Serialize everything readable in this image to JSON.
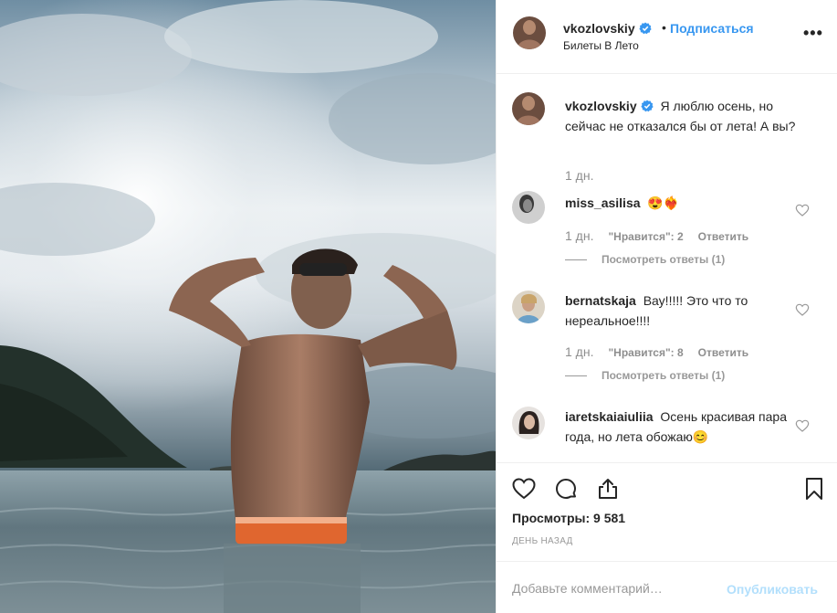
{
  "header": {
    "username": "vkozlovskiy",
    "separator": "•",
    "follow_label": "Подписаться",
    "location": "Билеты В Лето",
    "more_label": "•••"
  },
  "caption": {
    "username": "vkozlovskiy",
    "text": "Я люблю осень, но сейчас не отказался бы от лета! А вы?",
    "age": "1 дн."
  },
  "comments": [
    {
      "username": "miss_asilisa",
      "text": "😍❤️‍🔥",
      "age": "1 дн.",
      "likes": "\"Нравится\": 2",
      "reply_label": "Ответить",
      "view_replies": "Посмотреть ответы (1)"
    },
    {
      "username": "bernatskaja",
      "text": "Вау!!!!! Это что то нереальное!!!!",
      "age": "1 дн.",
      "likes": "\"Нравится\": 8",
      "reply_label": "Ответить",
      "view_replies": "Посмотреть ответы (1)"
    },
    {
      "username": "iaretskaiaiuliia",
      "text": "Осень красивая пара года, но лета обожаю😊"
    }
  ],
  "actions": {
    "views": "Просмотры: 9 581",
    "date": "ДЕНЬ НАЗАД"
  },
  "add_comment": {
    "placeholder": "Добавьте комментарий…",
    "publish_label": "Опубликовать"
  },
  "icons": {
    "verified": "verified-badge-icon",
    "like": "heart-icon",
    "comment": "comment-bubble-icon",
    "share": "share-icon",
    "save": "bookmark-icon"
  },
  "colors": {
    "link_blue": "#3897f0",
    "publish_disabled": "#b2dffc",
    "muted_text": "#999999"
  }
}
